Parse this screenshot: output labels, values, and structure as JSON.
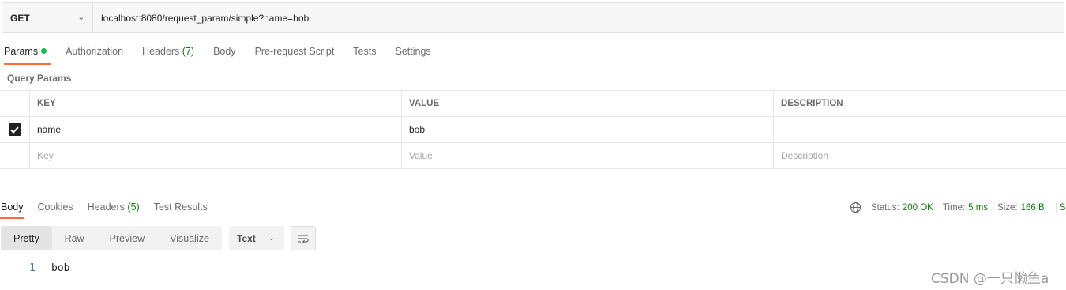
{
  "url_bar": {
    "method": "GET",
    "url": "localhost:8080/request_param/simple?name=bob"
  },
  "request_tabs": {
    "params": "Params",
    "authorization": "Authorization",
    "headers": "Headers",
    "headers_count": "(7)",
    "body": "Body",
    "pre_request_script": "Pre-request Script",
    "tests": "Tests",
    "settings": "Settings"
  },
  "query_params": {
    "title": "Query Params",
    "columns": {
      "key": "KEY",
      "value": "VALUE",
      "description": "DESCRIPTION"
    },
    "rows": [
      {
        "checked": true,
        "key": "name",
        "value": "bob",
        "description": ""
      }
    ],
    "placeholders": {
      "key": "Key",
      "value": "Value",
      "description": "Description"
    }
  },
  "response_tabs": {
    "body": "Body",
    "cookies": "Cookies",
    "headers": "Headers",
    "headers_count": "(5)",
    "test_results": "Test Results"
  },
  "status_bar": {
    "status_label": "Status:",
    "status_value": "200 OK",
    "time_label": "Time:",
    "time_value": "5 ms",
    "size_label": "Size:",
    "size_value": "166 B",
    "truncated": "S"
  },
  "view_modes": {
    "pretty": "Pretty",
    "raw": "Raw",
    "preview": "Preview",
    "visualize": "Visualize",
    "format": "Text"
  },
  "response_body": {
    "line_number": "1",
    "content": "bob"
  },
  "watermark": "CSDN @一只懒鱼a",
  "colors": {
    "accent_orange": "#ff6c37",
    "success_green": "#0f7b0f",
    "dot_green": "#0cbb52"
  }
}
